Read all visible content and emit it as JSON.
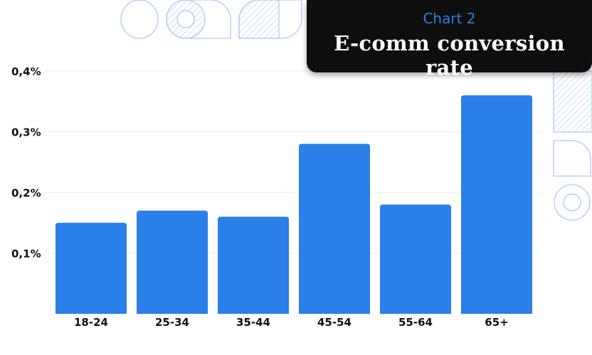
{
  "header": {
    "subtitle": "Chart 2",
    "title": "E-comm conversion rate"
  },
  "colors": {
    "bar": "#2a7fe8",
    "decoration": "#a9c9f3",
    "title_bg": "#0e0e0e",
    "subtitle": "#2a7fe8"
  },
  "chart_data": {
    "type": "bar",
    "title": "E-comm conversion rate",
    "subtitle": "Chart 2",
    "categories": [
      "18-24",
      "25-34",
      "35-44",
      "45-54",
      "55-64",
      "65+"
    ],
    "values": [
      0.15,
      0.17,
      0.16,
      0.28,
      0.18,
      0.36
    ],
    "unit": "%",
    "ylim": [
      0,
      0.4
    ],
    "yticks": [
      0.1,
      0.2,
      0.3,
      0.4
    ],
    "ytick_labels": [
      "0,1%",
      "0,2%",
      "0,3%",
      "0,4%"
    ],
    "grid": true,
    "xlabel": "",
    "ylabel": ""
  }
}
